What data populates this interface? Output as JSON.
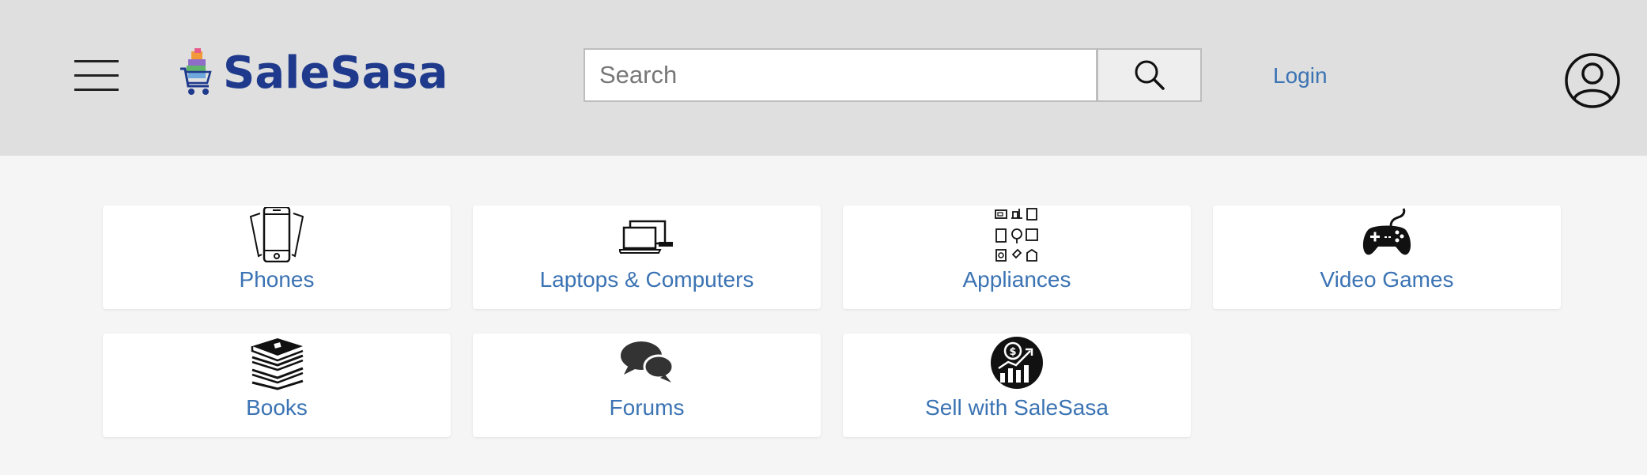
{
  "header": {
    "logo_text": "SaleSasa",
    "search_placeholder": "Search",
    "search_value": "",
    "login_label": "Login"
  },
  "categories": [
    {
      "label": "Phones",
      "icon": "phones-icon"
    },
    {
      "label": "Laptops & Computers",
      "icon": "laptops-icon"
    },
    {
      "label": "Appliances",
      "icon": "appliances-icon"
    },
    {
      "label": "Video Games",
      "icon": "gamepad-icon"
    },
    {
      "label": "Books",
      "icon": "books-icon"
    },
    {
      "label": "Forums",
      "icon": "chat-bubbles-icon"
    },
    {
      "label": "Sell with SaleSasa",
      "icon": "sell-growth-icon"
    }
  ],
  "colors": {
    "brand": "#1f3a8c",
    "link": "#3b73b3",
    "header_bg": "#dfdfdf",
    "page_bg": "#f5f5f5"
  }
}
